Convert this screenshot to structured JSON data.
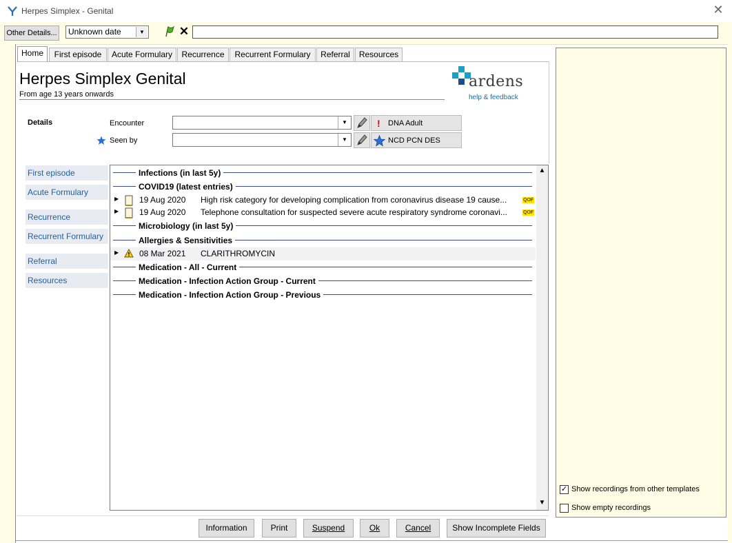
{
  "window": {
    "title": "Herpes Simplex - Genital",
    "close_glyph": "✕"
  },
  "toolbar": {
    "other_details_label": "Other Details...",
    "date_value": "Unknown date",
    "free_text_value": ""
  },
  "tabs": [
    {
      "label": "Home",
      "active": true
    },
    {
      "label": "First episode"
    },
    {
      "label": "Acute Formulary"
    },
    {
      "label": "Recurrence"
    },
    {
      "label": "Recurrent Formulary"
    },
    {
      "label": "Referral"
    },
    {
      "label": "Resources"
    }
  ],
  "header": {
    "title": "Herpes Simplex Genital",
    "subtitle": "From age 13 years onwards",
    "logo_text": "ardens",
    "help_link": "help & feedback"
  },
  "details": {
    "label": "Details",
    "encounter_label": "Encounter",
    "encounter_value": "",
    "seen_by_label": "Seen by",
    "seen_by_value": "",
    "dna_label": "DNA Adult",
    "ncd_label": "NCD PCN DES"
  },
  "nav": [
    "First episode",
    "Acute Formulary",
    "Recurrence",
    "Recurrent Formulary",
    "Referral",
    "Resources"
  ],
  "tree": {
    "sections": {
      "infections": "Infections (in last 5y)",
      "covid": "COVID19 (latest entries)",
      "micro": "Microbiology (in last 5y)",
      "allergies": "Allergies & Sensitivities",
      "med_all": "Medication - All - Current",
      "med_iag_current": "Medication - Infection Action Group - Current",
      "med_iag_previous": "Medication - Infection Action Group - Previous"
    },
    "covid_rows": [
      {
        "date": "19 Aug 2020",
        "text": "High risk category for developing complication from coronavirus disease 19 cause...",
        "badge": "QOF"
      },
      {
        "date": "19 Aug 2020",
        "text": "Telephone consultation for suspected severe acute respiratory syndrome coronavi...",
        "badge": "QOF"
      }
    ],
    "allergy_rows": [
      {
        "date": "08 Mar 2021",
        "text": "CLARITHROMYCIN"
      }
    ]
  },
  "buttons": {
    "information": "Information",
    "print": "Print",
    "suspend": "Suspend",
    "ok": "Ok",
    "cancel": "Cancel",
    "show_incomplete": "Show Incomplete Fields"
  },
  "right_panel": {
    "show_other_templates": {
      "label": "Show recordings from other templates",
      "checked": true
    },
    "show_empty": {
      "label": "Show empty recordings",
      "checked": false
    }
  },
  "colors": {
    "accent": "#1f5fa3",
    "panel_yellow": "#fffde6",
    "section_line": "#3c4a8c",
    "qof_badge": "#ffe400"
  }
}
